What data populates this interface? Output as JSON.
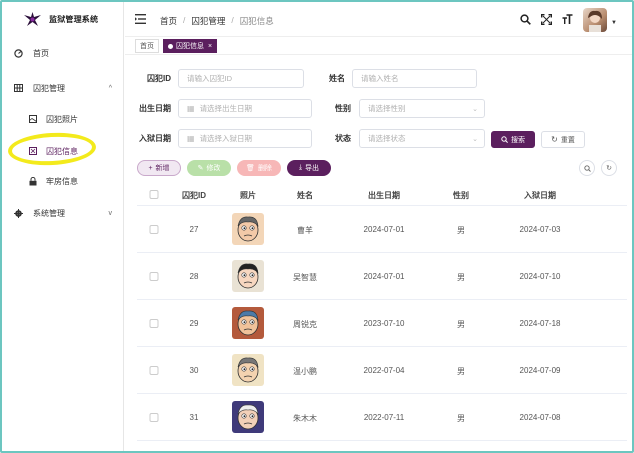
{
  "sidebar": {
    "app_title": "监狱管理系统",
    "items": [
      {
        "label": "首页",
        "icon": "dashboard-icon"
      },
      {
        "label": "囚犯管理",
        "icon": "grid-icon",
        "chevron": "^"
      },
      {
        "label": "囚犯照片",
        "icon": "picture-icon"
      },
      {
        "label": "囚犯信息",
        "icon": "id-card-icon"
      },
      {
        "label": "牢房信息",
        "icon": "lock-icon"
      },
      {
        "label": "系统管理",
        "icon": "gear-icon",
        "chevron": "v"
      }
    ]
  },
  "header": {
    "crumbs": [
      "首页",
      "/",
      "囚犯管理",
      "/",
      "囚犯信息"
    ]
  },
  "tags": {
    "home": "首页",
    "active": "囚犯信息",
    "close": "×"
  },
  "filters": {
    "prisoner_id": {
      "label": "囚犯ID",
      "placeholder": "请输入囚犯ID"
    },
    "name": {
      "label": "姓名",
      "placeholder": "请输入姓名"
    },
    "birth_date": {
      "label": "出生日期",
      "placeholder": "请选择出生日期"
    },
    "gender": {
      "label": "性别",
      "placeholder": "请选择性别"
    },
    "entry_date": {
      "label": "入狱日期",
      "placeholder": "请选择入狱日期"
    },
    "status": {
      "label": "状态",
      "placeholder": "请选择状态"
    },
    "search_btn": "搜索",
    "reset_btn": "重置"
  },
  "toolbar": {
    "add": "新增",
    "edit": "修改",
    "delete": "删除",
    "export": "导出"
  },
  "table": {
    "headers": [
      "囚犯ID",
      "照片",
      "姓名",
      "出生日期",
      "性别",
      "入狱日期"
    ],
    "rows": [
      {
        "id": "27",
        "name": "曹羊",
        "birth": "2024-07-01",
        "gender": "男",
        "entry": "2024-07-03",
        "bg": "#f3d6b8"
      },
      {
        "id": "28",
        "name": "吴智慧",
        "birth": "2024-07-01",
        "gender": "男",
        "entry": "2024-07-10",
        "bg": "#e9e2d4"
      },
      {
        "id": "29",
        "name": "周锐克",
        "birth": "2023-07-10",
        "gender": "男",
        "entry": "2024-07-18",
        "bg": "#b45a3c"
      },
      {
        "id": "30",
        "name": "温小鹏",
        "birth": "2022-07-04",
        "gender": "男",
        "entry": "2024-07-09",
        "bg": "#f0e3c4"
      },
      {
        "id": "31",
        "name": "朱木木",
        "birth": "2022-07-11",
        "gender": "男",
        "entry": "2024-07-08",
        "bg": "#3f3a7a"
      }
    ]
  },
  "colors": {
    "primary": "#5b1f5e",
    "highlight": "#f3ea1c",
    "frame": "#6cc6c0"
  }
}
